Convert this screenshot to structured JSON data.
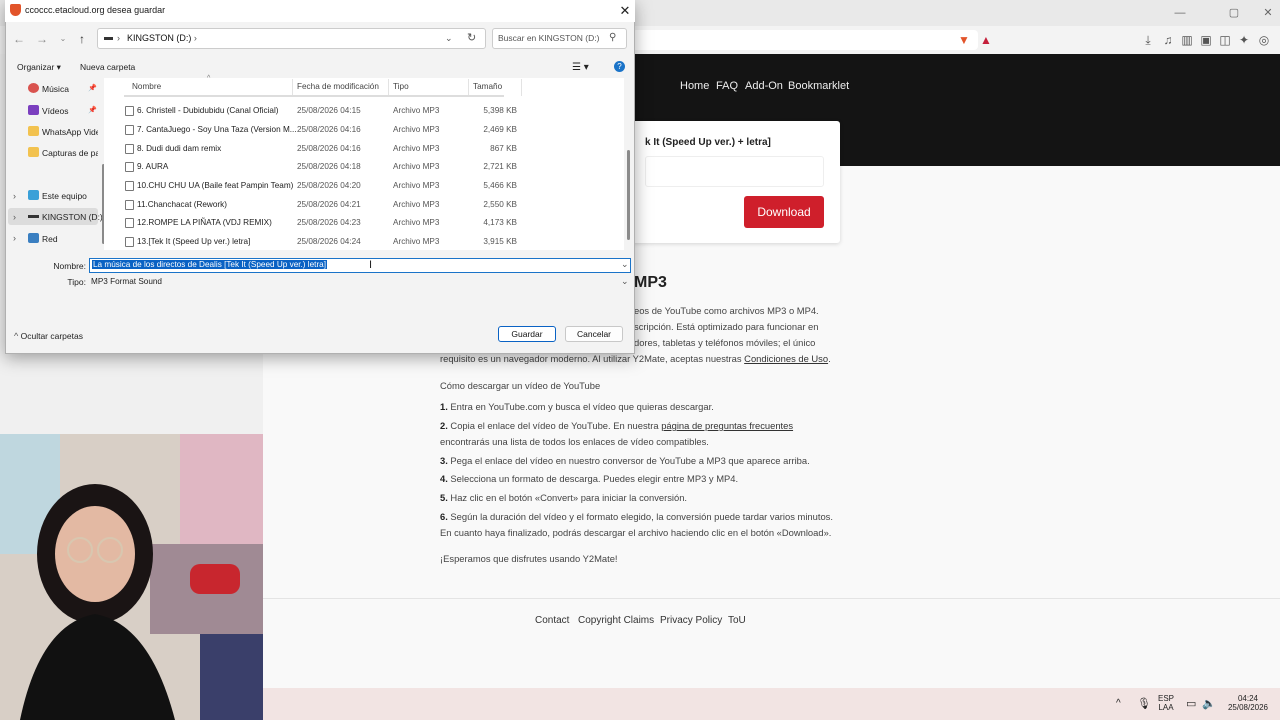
{
  "browser": {
    "window_controls": [
      "—",
      "▢",
      "✕"
    ],
    "toolbar_icons": [
      "download-icon",
      "library-icon",
      "sidebar-icon",
      "wallet-icon",
      "extension-icon",
      "ai-icon",
      "shield-icon",
      "menu-icon"
    ]
  },
  "site": {
    "nav": [
      "Home",
      "FAQ",
      "Add-On",
      "Bookmarklet"
    ],
    "card_title": "k It (Speed Up ver.) + letra]",
    "download_label": "Download",
    "heading": "MP3",
    "paragraph_lines": [
      "eos de YouTube como archivos MP3 o MP4.",
      "scripción. Está optimizado para funcionar en",
      "dores, tabletas y teléfonos móviles; el único"
    ],
    "requirement_prefix": "requisito es un navegador moderno. Al utilizar Y2Mate, aceptas nuestras ",
    "terms_link": "Condiciones de Uso",
    "requirement_suffix": ".",
    "howto_title": "Cómo descargar un vídeo de YouTube",
    "steps": [
      {
        "num": "1.",
        "text": " Entra en YouTube.com y busca el vídeo que quieras descargar."
      },
      {
        "num": "2.",
        "text": " Copia el enlace del vídeo de YouTube. En nuestra ",
        "link": "página de preguntas frecuentes"
      },
      {
        "num": "",
        "text": "encontrarás una lista de todos los enlaces de vídeo compatibles."
      },
      {
        "num": "3.",
        "text": " Pega el enlace del vídeo en nuestro conversor de YouTube a MP3 que aparece arriba."
      },
      {
        "num": "4.",
        "text": " Selecciona un formato de descarga. Puedes elegir entre MP3 y MP4."
      },
      {
        "num": "5.",
        "text": " Haz clic en el botón «Convert» para iniciar la conversión."
      },
      {
        "num": "6.",
        "text": " Según la duración del vídeo y el formato elegido, la conversión puede tardar varios minutos."
      },
      {
        "num": "",
        "text": "En cuanto haya finalizado, podrás descargar el archivo haciendo clic en el botón «Download»."
      }
    ],
    "closing": "¡Esperamos que disfrutes usando Y2Mate!",
    "footer_links": [
      "Contact",
      "Copyright Claims",
      "Privacy Policy",
      "ToU"
    ]
  },
  "dialog": {
    "title": "ccoccc.etacloud.org desea guardar",
    "address": "KINGSTON (D:)",
    "search_placeholder": "Buscar en KINGSTON (D:)",
    "organize": "Organizar ▾",
    "new_folder": "Nueva carpeta",
    "nav_items": [
      "Música",
      "Vídeos",
      "WhatsApp Vide",
      "Capturas de par",
      "Este equipo",
      "KINGSTON (D:)",
      "Red"
    ],
    "columns": [
      "Nombre",
      "Fecha de modificación",
      "Tipo",
      "Tamaño"
    ],
    "files": [
      {
        "name": "6. Christell - Dubidubidu (Canal Oficial)",
        "date": "25/08/2026 04:15",
        "type": "Archivo MP3",
        "size": "5,398 KB"
      },
      {
        "name": "7. CantaJuego - Soy Una Taza (Version M...",
        "date": "25/08/2026 04:16",
        "type": "Archivo MP3",
        "size": "2,469 KB"
      },
      {
        "name": "8. Dudi dudi dam remix",
        "date": "25/08/2026 04:16",
        "type": "Archivo MP3",
        "size": "867 KB"
      },
      {
        "name": "9. AURA",
        "date": "25/08/2026 04:18",
        "type": "Archivo MP3",
        "size": "2,721 KB"
      },
      {
        "name": "10.CHU CHU UA (Baile feat Pampin Team)",
        "date": "25/08/2026 04:20",
        "type": "Archivo MP3",
        "size": "5,466 KB"
      },
      {
        "name": "11.Chanchacat (Rework)",
        "date": "25/08/2026 04:21",
        "type": "Archivo MP3",
        "size": "2,550 KB"
      },
      {
        "name": "12.ROMPE LA PIÑATA (VDJ REMIX)",
        "date": "25/08/2026 04:23",
        "type": "Archivo MP3",
        "size": "4,173 KB"
      },
      {
        "name": "13.[Tek It (Speed Up ver.)  letra]",
        "date": "25/08/2026 04:24",
        "type": "Archivo MP3",
        "size": "3,915 KB"
      }
    ],
    "name_label": "Nombre:",
    "name_value": "La música de los directos de Dealis [Tek It (Speed Up ver.)  letra]",
    "type_label": "Tipo:",
    "type_value": "MP3 Format Sound",
    "save_label": "Guardar",
    "cancel_label": "Cancelar",
    "hide_folders": "Ocultar carpetas"
  },
  "taskbar": {
    "lang": "ESP",
    "region": "LAA",
    "time": "04:24",
    "date": "25/08/2026"
  }
}
